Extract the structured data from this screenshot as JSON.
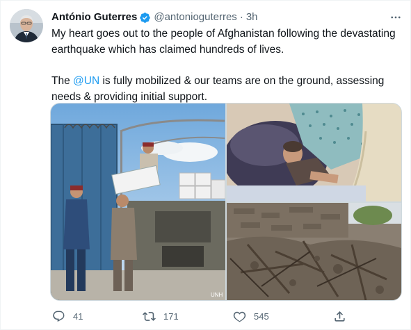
{
  "tweet": {
    "author_name": "António Guterres",
    "handle": "@antonioguterres",
    "separator": "·",
    "time": "3h",
    "text_part1": "My heart goes out to the people of Afghanistan following the devastating earthquake which has claimed hundreds of lives.",
    "text_part2_prefix": "The ",
    "mention": "@UN",
    "text_part2_suffix": " is fully mobilized & our teams are on the ground, assessing needs & providing initial support.",
    "photo_watermark": "UNH"
  },
  "actions": {
    "reply_count": "41",
    "retweet_count": "171",
    "like_count": "545"
  },
  "icons": {
    "verified": "verified-badge-icon",
    "more": "more-options-icon",
    "reply": "reply-icon",
    "retweet": "retweet-icon",
    "like": "heart-icon",
    "share": "share-icon"
  },
  "colors": {
    "accent": "#1d9bf0",
    "text": "#0f1419",
    "secondary": "#536471"
  }
}
